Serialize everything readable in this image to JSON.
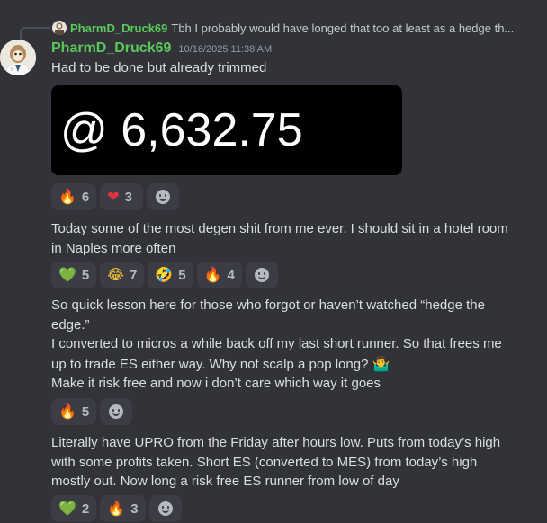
{
  "reply": {
    "username": "PharmD_Druck69",
    "text": "Tbh I probably would  have longed that too at least as a hedge th..."
  },
  "message_header": {
    "username": "PharmD_Druck69",
    "timestamp": "10/16/2025 11:38 AM"
  },
  "messages": [
    {
      "lines": [
        "Had to be done but already trimmed"
      ],
      "embed_text": "@ 6,632.75",
      "reactions": [
        {
          "emoji": "🔥",
          "count": "6",
          "icon": "fire-icon"
        },
        {
          "emoji": "❤",
          "count": "3",
          "icon": "red-heart-icon"
        }
      ]
    },
    {
      "lines": [
        "Today some of the most degen shit from me ever. I should sit in a hotel room",
        "in Naples more often"
      ],
      "reactions": [
        {
          "emoji": "💚",
          "count": "5",
          "icon": "green-heart-icon"
        },
        {
          "emoji": "😂",
          "count": "7",
          "icon": "tears-of-joy-icon"
        },
        {
          "emoji": "🤣",
          "count": "5",
          "icon": "rofl-icon"
        },
        {
          "emoji": "🔥",
          "count": "4",
          "icon": "fire-icon"
        }
      ]
    },
    {
      "lines": [
        "So quick lesson here for those who forgot or haven’t watched “hedge the",
        "edge.”",
        "I converted to micros a while back off my last short runner. So that frees me",
        "up to trade ES either way. Why not scalp a pop long?",
        "Make it risk free and now i don’t care  which way it goes"
      ],
      "shrug_emoji": "🤷‍♂️",
      "reactions": [
        {
          "emoji": "🔥",
          "count": "5",
          "icon": "fire-icon"
        }
      ]
    },
    {
      "lines": [
        "Literally have UPRO from the Friday after hours low. Puts from today’s high",
        "with some profits taken. Short ES (converted to MES) from today’s high",
        "mostly out. Now long a risk free ES runner from low of day"
      ],
      "reactions": [
        {
          "emoji": "💚",
          "count": "2",
          "icon": "green-heart-icon"
        },
        {
          "emoji": "🔥",
          "count": "3",
          "icon": "fire-icon"
        }
      ]
    }
  ],
  "colors": {
    "background": "#323339",
    "username": "#5ac85a",
    "text": "#dbdee1",
    "reaction_bg": "#3c3d44"
  }
}
